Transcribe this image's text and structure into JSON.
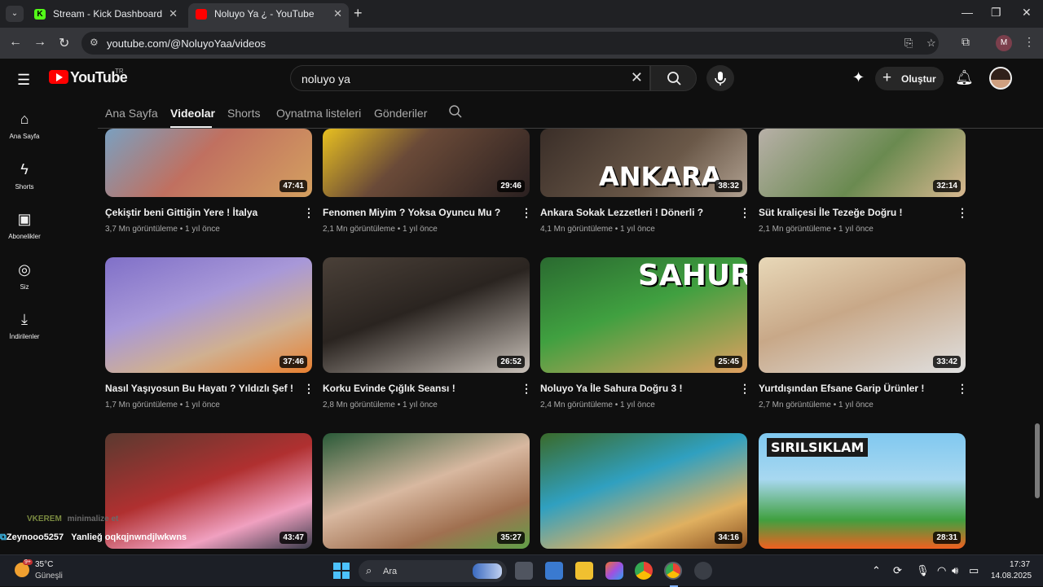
{
  "browser": {
    "tabs": [
      {
        "title": "Stream - Kick Dashboard",
        "active": false
      },
      {
        "title": "Noluyo Ya ¿ - YouTube",
        "active": true
      }
    ],
    "url": "youtube.com/@NoluyoYaa/videos",
    "profile_initial": "M"
  },
  "youtube": {
    "logo_text": "YouTube",
    "country_code": "TR",
    "search_value": "noluyo ya",
    "create_label": "Oluştur"
  },
  "sidebar": {
    "items": [
      {
        "label": "Ana Sayfa",
        "icon": "home-icon"
      },
      {
        "label": "Shorts",
        "icon": "shorts-icon"
      },
      {
        "label": "Abonelikler",
        "icon": "subscriptions-icon"
      },
      {
        "label": "Siz",
        "icon": "you-icon"
      },
      {
        "label": "İndirilenler",
        "icon": "downloads-icon"
      }
    ]
  },
  "channel_tabs": [
    "Ana Sayfa",
    "Videolar",
    "Shorts",
    "Oynatma listeleri",
    "Gönderiler"
  ],
  "active_tab": "Videolar",
  "videos": [
    {
      "title": "Çekiştir beni Gittiğin Yere ! İtalya",
      "views": "3,7 Mn görüntüleme",
      "age": "1 yıl önce",
      "duration": "47:41"
    },
    {
      "title": "Fenomen Miyim ? Yoksa Oyuncu Mu ?",
      "views": "2,1 Mn görüntüleme",
      "age": "1 yıl önce",
      "duration": "29:46"
    },
    {
      "title": "Ankara Sokak Lezzetleri ! Dönerli ?",
      "views": "4,1 Mn görüntüleme",
      "age": "1 yıl önce",
      "duration": "38:32",
      "overlay": "ANKARA"
    },
    {
      "title": "Süt kraliçesi İle Tezeğe Doğru !",
      "views": "2,1 Mn görüntüleme",
      "age": "1 yıl önce",
      "duration": "32:14"
    },
    {
      "title": "Nasıl Yaşıyosun Bu Hayatı ? Yıldızlı Şef !",
      "views": "1,7 Mn görüntüleme",
      "age": "1 yıl önce",
      "duration": "37:46"
    },
    {
      "title": "Korku Evinde Çığlık Seansı !",
      "views": "2,8 Mn görüntüleme",
      "age": "1 yıl önce",
      "duration": "26:52"
    },
    {
      "title": "Noluyo Ya İle Sahura Doğru 3 !",
      "views": "2,4 Mn görüntüleme",
      "age": "1 yıl önce",
      "duration": "25:45",
      "overlay": "SAHUR"
    },
    {
      "title": "Yurtdışından Efsane Garip Ürünler !",
      "views": "2,7 Mn görüntüleme",
      "age": "1 yıl önce",
      "duration": "33:42"
    },
    {
      "title": "",
      "views": "",
      "age": "",
      "duration": "43:47"
    },
    {
      "title": "",
      "views": "",
      "age": "",
      "duration": "35:27"
    },
    {
      "title": "",
      "views": "",
      "age": "",
      "duration": "34:16"
    },
    {
      "title": "",
      "views": "",
      "age": "",
      "duration": "28:31",
      "overlay": "SIRILSIKLAM"
    }
  ],
  "chat_overlay": {
    "line1_user": "VKEREM",
    "line1_text": "minimalize et",
    "line2_user": "Zeynooo5257",
    "line2_text": "Yanlieğ oqkqjnwndjlwkwns"
  },
  "taskbar": {
    "temperature": "35°C",
    "weather": "Güneşli",
    "weather_badge": "9+",
    "search_placeholder": "Ara",
    "time": "17:37",
    "date": "14.08.2025"
  },
  "colors": {
    "background": "#0f0f0f",
    "youtube_red": "#ff0000",
    "kick_green": "#53fc18"
  }
}
